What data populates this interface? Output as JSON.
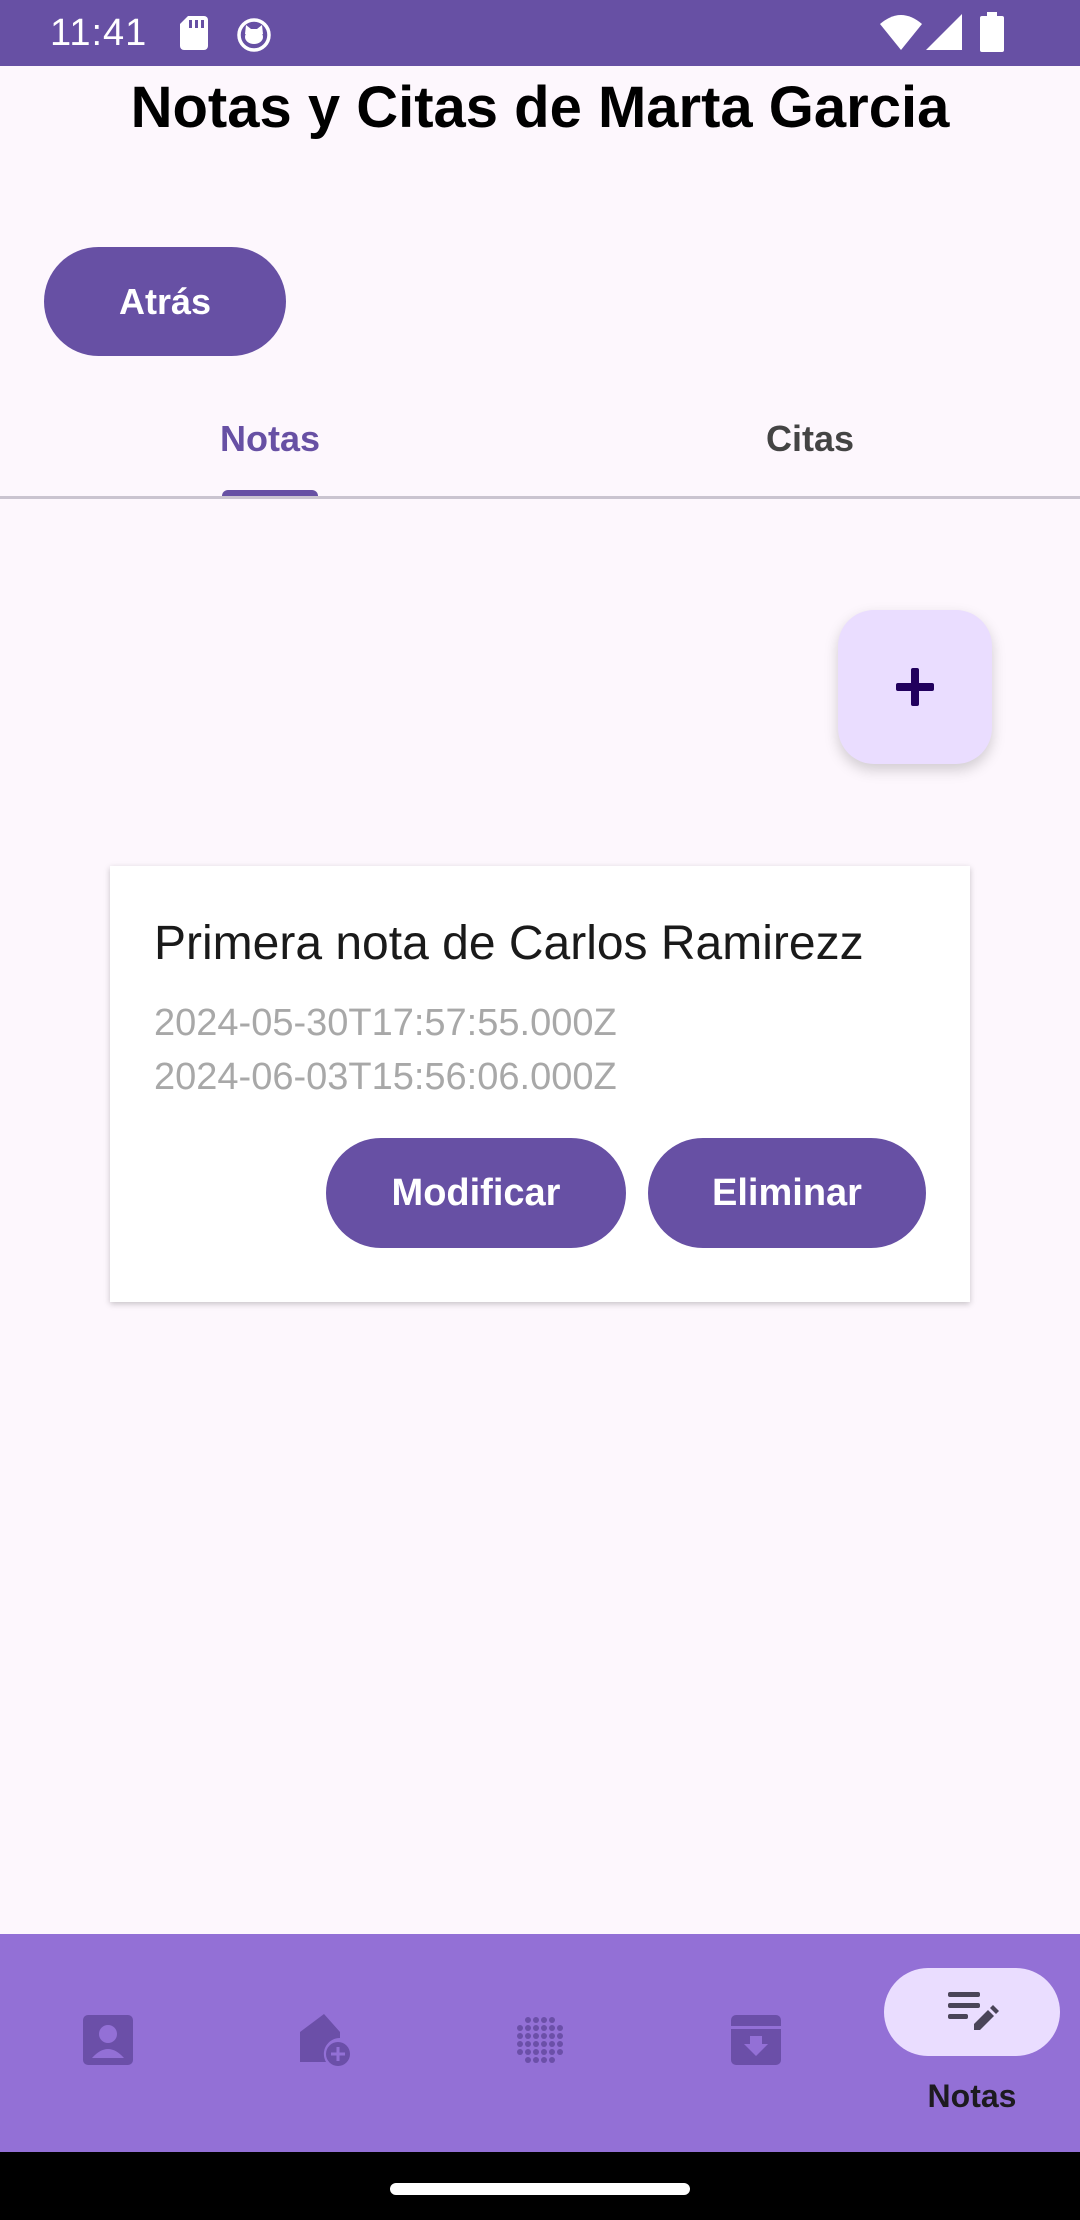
{
  "status_bar": {
    "time": "11:41",
    "icons": [
      "sd-card-icon",
      "cat-icon",
      "wifi-icon",
      "signal-icon",
      "battery-icon"
    ]
  },
  "header": {
    "title": "Notas y Citas de Marta Garcia",
    "back_label": "Atrás"
  },
  "tabs": [
    {
      "label": "Notas",
      "selected": true
    },
    {
      "label": "Citas",
      "selected": false
    }
  ],
  "fab": {
    "icon": "plus-icon"
  },
  "notes": [
    {
      "title": "Primera nota de Carlos Ramirezz",
      "created": "2024-05-30T17:57:55.000Z",
      "updated": "2024-06-03T15:56:06.000Z",
      "modify_label": "Modificar",
      "delete_label": "Eliminar"
    }
  ],
  "bottom_nav": {
    "items": [
      {
        "icon": "contact-icon"
      },
      {
        "icon": "add-home-icon"
      },
      {
        "icon": "dots-grid-icon"
      },
      {
        "icon": "archive-icon"
      },
      {
        "icon": "notes-edit-icon",
        "label": "Notas",
        "active": true
      }
    ]
  },
  "colors": {
    "primary": "#6750a4",
    "nav_background": "#9370d6",
    "fab_background": "#eaddff",
    "page_background": "#fdf7fd"
  }
}
